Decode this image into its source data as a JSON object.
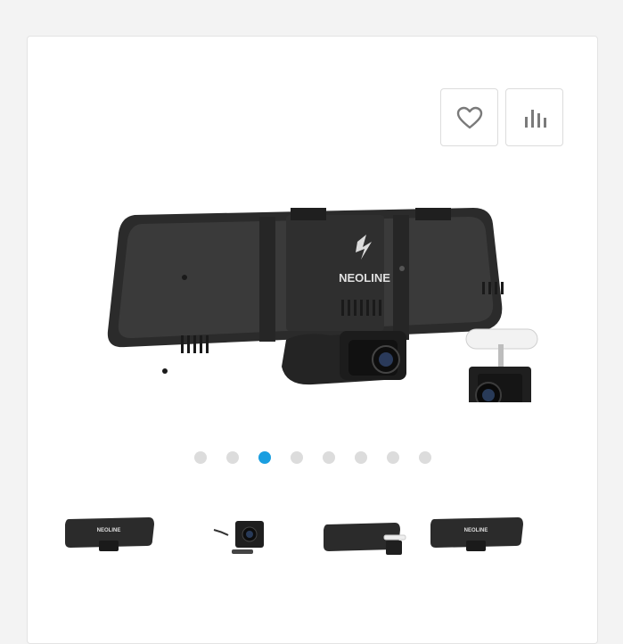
{
  "product": {
    "brand_logo_text": "NEOLINE",
    "actions": {
      "favorite_icon": "heart-icon",
      "compare_icon": "bar-chart-icon"
    },
    "gallery": {
      "slide_count": 8,
      "active_index": 2,
      "thumbnails": [
        "rear view with cameras",
        "rear camera",
        "mirror with rear camera",
        "mirror rear view"
      ]
    }
  },
  "colors": {
    "accent": "#1a9ee0",
    "dot_inactive": "#dcdcdc",
    "device_body": "#2b2b2b"
  }
}
